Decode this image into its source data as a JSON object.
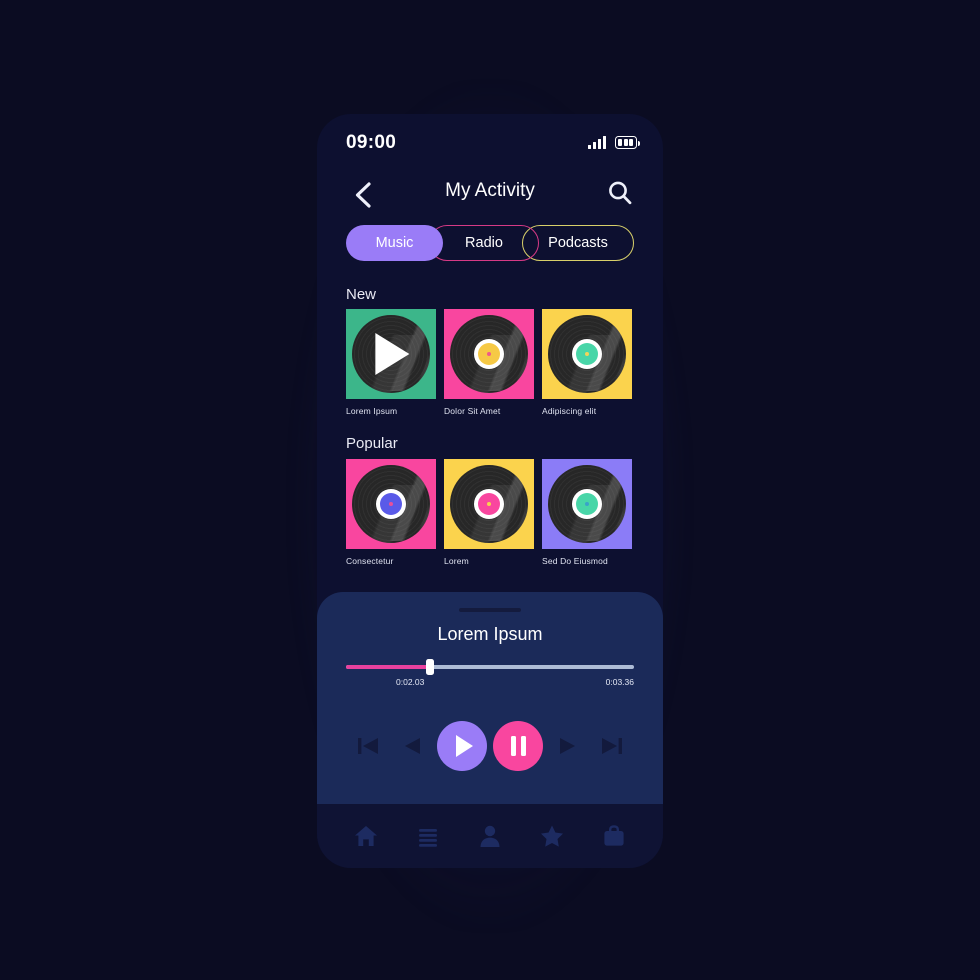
{
  "statusbar": {
    "time": "09:00",
    "signal_icon": "signal-bars-icon",
    "battery_icon": "battery-icon"
  },
  "header": {
    "title": "My Activity",
    "back_icon": "chevron-left-icon",
    "search_icon": "search-icon"
  },
  "tabs": [
    {
      "label": "Music",
      "state": "selected",
      "color": "#9a7cf7"
    },
    {
      "label": "Radio",
      "state": "outline",
      "color": "#d63a86"
    },
    {
      "label": "Podcasts",
      "state": "outline",
      "color": "#d8d06a"
    }
  ],
  "sections": [
    {
      "title": "New",
      "cards": [
        {
          "label": "Lorem Ipsum",
          "bg": "#3cb68a",
          "label_color": "#ffffff",
          "hole": "#ffffff",
          "overlay": "play-triangle"
        },
        {
          "label": "Dolor Sit Amet",
          "bg": "#f9469f",
          "label_color": "#f6c945",
          "hole": "#ef5a8a",
          "overlay": "none"
        },
        {
          "label": "Adipiscing elit",
          "bg": "#fbd council",
          "label_color": "#48d6a8",
          "hole": "#f2d45a",
          "overlay": "none"
        }
      ]
    },
    {
      "title": "Popular",
      "cards": [
        {
          "label": "Consectetur",
          "bg": "#f9469f",
          "label_color": "#5a5ae8",
          "hole": "#e8509a",
          "overlay": "none"
        },
        {
          "label": "Lorem",
          "bg": "#fbd34d",
          "label_color": "#f9469f",
          "hole": "#f6d24f",
          "overlay": "none"
        },
        {
          "label": "Sed Do Eiusmod",
          "bg": "#8b7cf7",
          "label_color": "#48d6a8",
          "hole": "#3aa3c9",
          "overlay": "none"
        }
      ]
    }
  ],
  "player": {
    "track_title": "Lorem Ipsum",
    "current_time": "0:02.03",
    "total_time": "0:03.36",
    "progress_percent": 29,
    "progress_color": "#e8419e",
    "controls": [
      {
        "name": "skip-previous-button",
        "icon": "skip-previous-icon"
      },
      {
        "name": "rewind-button",
        "icon": "rewind-icon"
      },
      {
        "name": "play-button",
        "icon": "play-icon",
        "bg": "#9a7cf7"
      },
      {
        "name": "pause-button",
        "icon": "pause-icon",
        "bg": "#f9469f"
      },
      {
        "name": "fast-forward-button",
        "icon": "fast-forward-icon"
      },
      {
        "name": "skip-next-button",
        "icon": "skip-next-icon"
      }
    ]
  },
  "bottom_nav": [
    {
      "name": "nav-home",
      "icon": "home-icon"
    },
    {
      "name": "nav-list",
      "icon": "list-icon"
    },
    {
      "name": "nav-profile",
      "icon": "person-icon"
    },
    {
      "name": "nav-favorites",
      "icon": "star-icon"
    },
    {
      "name": "nav-bag",
      "icon": "briefcase-icon"
    }
  ]
}
